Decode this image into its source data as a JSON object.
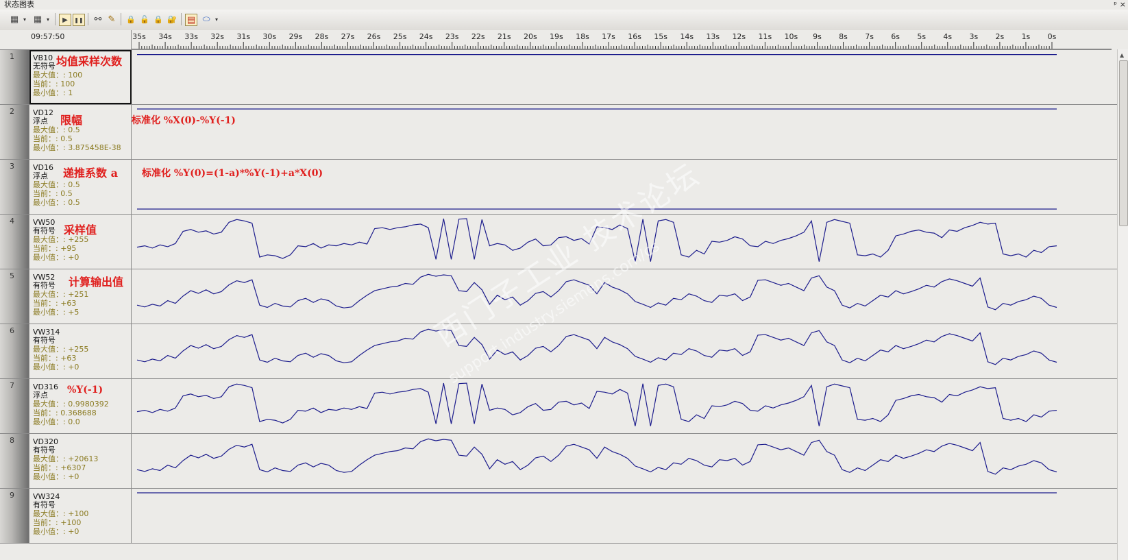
{
  "window": {
    "title": "状态图表",
    "pin_glyph": "ᵖ",
    "close_glyph": "×"
  },
  "toolbar": {
    "buttons": [
      {
        "name": "add-trend-icon",
        "glyph": "▦"
      },
      {
        "name": "remove-trend-icon",
        "glyph": "▦"
      },
      {
        "name": "run-icon",
        "glyph": "▶"
      },
      {
        "name": "pause-icon",
        "glyph": "❚❚"
      },
      {
        "name": "glasses-icon",
        "glyph": "⚯"
      },
      {
        "name": "pencil-icon",
        "glyph": "✎"
      },
      {
        "name": "lock-icon",
        "glyph": "🔒"
      },
      {
        "name": "unlock-icon",
        "glyph": "🔓"
      },
      {
        "name": "lock-add-icon",
        "glyph": "🔒"
      },
      {
        "name": "lock-read-icon",
        "glyph": "🔐"
      },
      {
        "name": "trend-view-icon",
        "glyph": "▤"
      },
      {
        "name": "tag-icon",
        "glyph": "⬭"
      }
    ],
    "dropdown_glyph": "▾"
  },
  "chart": {
    "timestamp": "09:57:50",
    "time_labels": [
      "35s",
      "34s",
      "33s",
      "32s",
      "31s",
      "30s",
      "29s",
      "28s",
      "27s",
      "26s",
      "25s",
      "24s",
      "23s",
      "22s",
      "21s",
      "20s",
      "19s",
      "18s",
      "17s",
      "16s",
      "15s",
      "14s",
      "13s",
      "12s",
      "11s",
      "10s",
      "9s",
      "8s",
      "7s",
      "6s",
      "5s",
      "4s",
      "3s",
      "2s",
      "1s",
      "0s"
    ],
    "line_color": "#1c1c8c"
  },
  "rows": [
    {
      "index": "1",
      "address": "VB10",
      "type": "无符号",
      "max": "最大值：: 100",
      "current": "当前：: 100",
      "min": "最小值：: 1",
      "annotation": "均值采样次数",
      "selected": true,
      "flat_level": 0.99
    },
    {
      "index": "2",
      "address": "VD12",
      "type": "浮点",
      "max": "最大值：: 0.5",
      "current": "当前：: 0.5",
      "min": "最小值：: 3.875458E-38",
      "annotation": "限幅",
      "formula": "标准化  %X(0)-%Y(-1)",
      "flat_level": 1.0
    },
    {
      "index": "3",
      "address": "VD16",
      "type": "浮点",
      "max": "最大值：: 0.5",
      "current": "当前：: 0.5",
      "min": "最小值：: 0.5",
      "annotation": "递推系数  a",
      "formula": "标准化  %Y(0)=(1-a)*%Y(-1)+a*X(0)",
      "flat_level": 0.0
    },
    {
      "index": "4",
      "address": "VW50",
      "type": "有符号",
      "max": "最大值：: +255",
      "current": "当前：: +95",
      "min": "最小值：: +0",
      "annotation": "采样值",
      "series": "raw"
    },
    {
      "index": "5",
      "address": "VW52",
      "type": "有符号",
      "max": "最大值：: +251",
      "current": "当前：: +63",
      "min": "最小值：: +5",
      "annotation": "计算输出值",
      "series": "smooth"
    },
    {
      "index": "6",
      "address": "VW314",
      "type": "有符号",
      "max": "最大值：: +255",
      "current": "当前：: +63",
      "min": "最小值：: +0",
      "series": "smooth"
    },
    {
      "index": "7",
      "address": "VD316",
      "type": "浮点",
      "max": "最大值：: 0.9980392",
      "current": "当前：: 0.368688",
      "min": "最小值：: 0.0",
      "annotation": "%Y(-1)",
      "series": "raw"
    },
    {
      "index": "8",
      "address": "VD320",
      "type": "有符号",
      "max": "最大值：: +20613",
      "current": "当前：: +6307",
      "min": "最小值：: +0",
      "series": "smooth"
    },
    {
      "index": "9",
      "address": "VW324",
      "type": "有符号",
      "max": "最大值：: +100",
      "current": "当前：: +100",
      "min": "最小值：: +0",
      "flat_level": 1.0
    }
  ],
  "trend_series": {
    "raw": [
      0.37,
      0.4,
      0.35,
      0.42,
      0.38,
      0.45,
      0.72,
      0.76,
      0.7,
      0.73,
      0.66,
      0.7,
      0.92,
      0.98,
      0.95,
      0.9,
      0.15,
      0.2,
      0.18,
      0.12,
      0.2,
      0.4,
      0.38,
      0.45,
      0.35,
      0.42,
      0.4,
      0.45,
      0.42,
      0.48,
      0.44,
      0.78,
      0.8,
      0.76,
      0.8,
      0.82,
      0.86,
      0.88,
      0.8,
      0.1,
      1.0,
      0.1,
      0.99,
      1.0,
      0.1,
      0.98,
      0.4,
      0.45,
      0.42,
      0.3,
      0.35,
      0.48,
      0.55,
      0.4,
      0.42,
      0.58,
      0.6,
      0.52,
      0.56,
      0.44,
      0.82,
      0.8,
      0.76,
      0.86,
      0.78,
      0.05,
      0.99,
      0.05,
      0.95,
      0.98,
      0.92,
      0.2,
      0.15,
      0.3,
      0.22,
      0.5,
      0.48,
      0.52,
      0.6,
      0.55,
      0.4,
      0.38,
      0.5,
      0.45,
      0.52,
      0.56,
      0.62,
      0.7,
      0.95,
      0.05,
      0.92,
      0.98,
      0.94,
      0.9,
      0.2,
      0.18,
      0.22,
      0.15,
      0.3,
      0.62,
      0.66,
      0.72,
      0.75,
      0.7,
      0.68,
      0.58,
      0.75,
      0.72,
      0.8,
      0.85,
      0.92,
      0.88,
      0.9,
      0.22,
      0.18,
      0.22,
      0.15,
      0.3,
      0.25,
      0.38,
      0.4
    ],
    "smooth": [
      0.3,
      0.26,
      0.32,
      0.28,
      0.4,
      0.34,
      0.5,
      0.62,
      0.56,
      0.64,
      0.55,
      0.6,
      0.75,
      0.84,
      0.8,
      0.86,
      0.3,
      0.25,
      0.34,
      0.28,
      0.26,
      0.4,
      0.45,
      0.36,
      0.44,
      0.4,
      0.28,
      0.24,
      0.26,
      0.4,
      0.52,
      0.62,
      0.66,
      0.7,
      0.72,
      0.78,
      0.76,
      0.92,
      0.98,
      0.94,
      0.97,
      0.95,
      0.62,
      0.6,
      0.8,
      0.64,
      0.32,
      0.52,
      0.42,
      0.48,
      0.3,
      0.4,
      0.56,
      0.6,
      0.48,
      0.62,
      0.82,
      0.86,
      0.8,
      0.74,
      0.55,
      0.8,
      0.7,
      0.64,
      0.55,
      0.38,
      0.32,
      0.25,
      0.35,
      0.3,
      0.45,
      0.42,
      0.55,
      0.5,
      0.4,
      0.36,
      0.52,
      0.5,
      0.55,
      0.4,
      0.48,
      0.85,
      0.86,
      0.8,
      0.74,
      0.78,
      0.7,
      0.62,
      0.9,
      0.95,
      0.7,
      0.62,
      0.3,
      0.24,
      0.34,
      0.28,
      0.4,
      0.52,
      0.48,
      0.62,
      0.55,
      0.6,
      0.66,
      0.74,
      0.7,
      0.82,
      0.88,
      0.84,
      0.78,
      0.72,
      0.9,
      0.26,
      0.2,
      0.34,
      0.3,
      0.38,
      0.42,
      0.5,
      0.45,
      0.3,
      0.25
    ]
  },
  "watermark": {
    "line1": "西门子工业 技术论坛",
    "line2": "support.industry.siemens.com/cs"
  }
}
